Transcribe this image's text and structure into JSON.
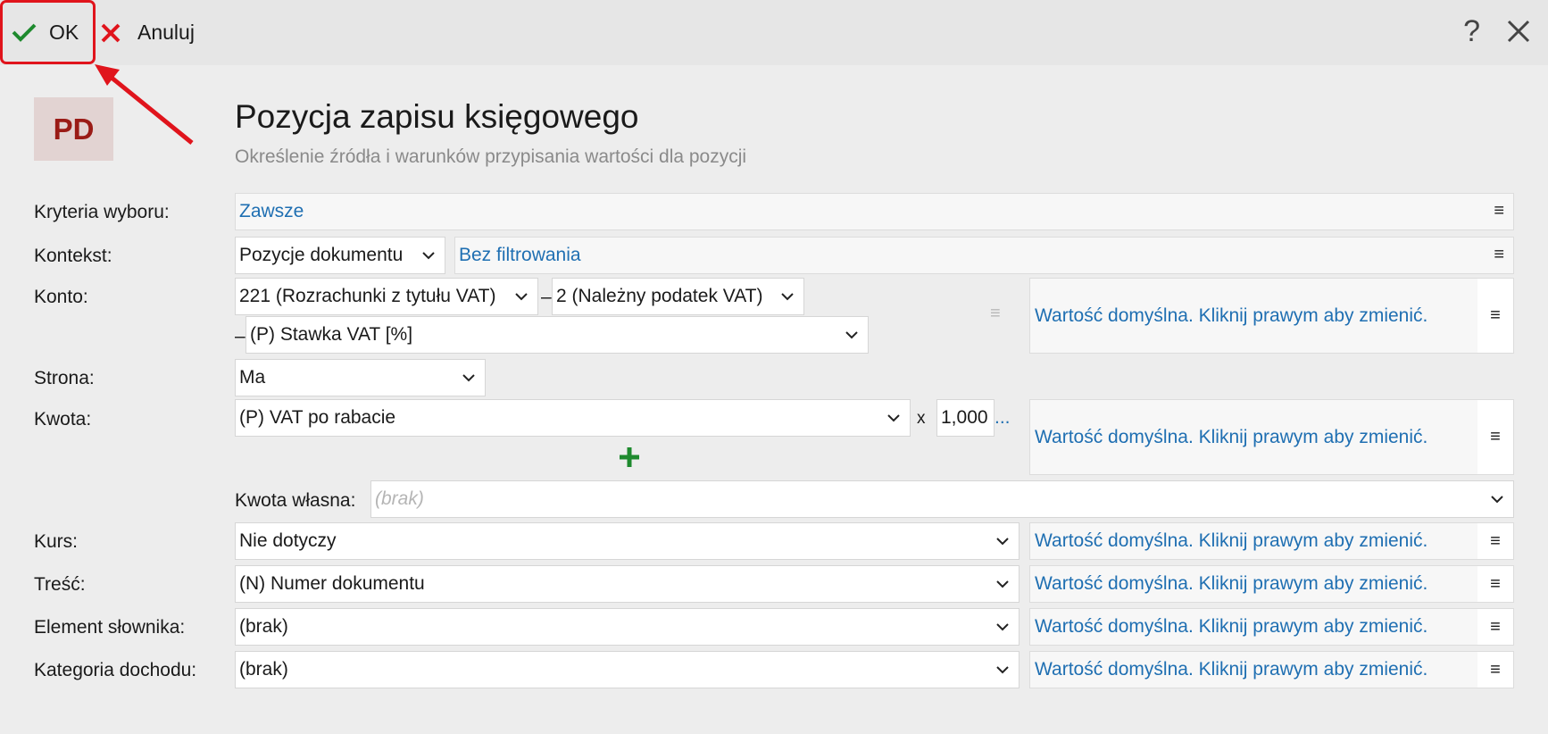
{
  "toolbar": {
    "ok_label": "OK",
    "cancel_label": "Anuluj",
    "help_label": "?"
  },
  "header": {
    "badge": "PD",
    "title": "Pozycja zapisu księgowego",
    "subtitle": "Określenie źródła i warunków przypisania wartości dla pozycji"
  },
  "form": {
    "kryteria": {
      "label": "Kryteria wyboru:",
      "value": "Zawsze"
    },
    "kontekst": {
      "label": "Kontekst:",
      "select": "Pozycje dokumentu",
      "filter": "Bez filtrowania"
    },
    "konto": {
      "label": "Konto:",
      "part1": "221 (Rozrachunki z tytułu VAT)",
      "sep1": "–",
      "part2": "2 (Należny podatek VAT)",
      "sep2": "–",
      "part3": "(P) Stawka VAT [%]"
    },
    "strona": {
      "label": "Strona:",
      "value": "Ma"
    },
    "kwota": {
      "label": "Kwota:",
      "value": "(P) VAT po rabacie",
      "multiplier_sign": "x",
      "multiplier": "1,000",
      "more": "..."
    },
    "kwota_wlasna": {
      "label": "Kwota własna:",
      "placeholder": "(brak)"
    },
    "kurs": {
      "label": "Kurs:",
      "value": "Nie dotyczy"
    },
    "tresc": {
      "label": "Treść:",
      "value": "(N) Numer dokumentu"
    },
    "element": {
      "label": "Element słownika:",
      "value": "(brak)"
    },
    "kategoria": {
      "label": "Kategoria dochodu:",
      "value": "(brak)"
    },
    "default_value_text": "Wartość domyślna. Kliknij prawym aby zmienić.",
    "menu_glyph": "≡"
  },
  "colors": {
    "accent_link": "#1f6fb2",
    "ok_check": "#1e8a2e",
    "cancel_x": "#e0141c",
    "badge_text": "#9a1b16",
    "badge_bg": "#e2d3d2",
    "highlight": "#e0141c",
    "add_plus": "#1e8a2e"
  }
}
